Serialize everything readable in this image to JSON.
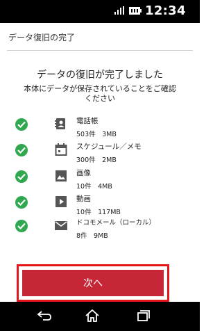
{
  "status_bar": {
    "time": "12:34"
  },
  "header": {
    "title": "データ復旧の完了"
  },
  "main": {
    "title": "データの復旧が完了しました",
    "subtitle_line1": "本体にデータが保存されていることをご確認",
    "subtitle_line2": "ください"
  },
  "items": [
    {
      "icon": "contacts-icon",
      "name": "電話帳",
      "count": "503件　3MB"
    },
    {
      "icon": "calendar-icon",
      "name": "スケジュール／メモ",
      "count": "300件　2MB"
    },
    {
      "icon": "image-icon",
      "name": "画像",
      "count": "10件　4MB"
    },
    {
      "icon": "video-icon",
      "name": "動画",
      "count": "10件　117MB"
    },
    {
      "icon": "mail-icon",
      "name": "ドコモメール（ローカル）",
      "count": "8件　9MB"
    }
  ],
  "next_button": {
    "label": "次へ"
  },
  "colors": {
    "check": "#2fa84f",
    "button": "#c72636",
    "highlight": "#e4161b"
  }
}
